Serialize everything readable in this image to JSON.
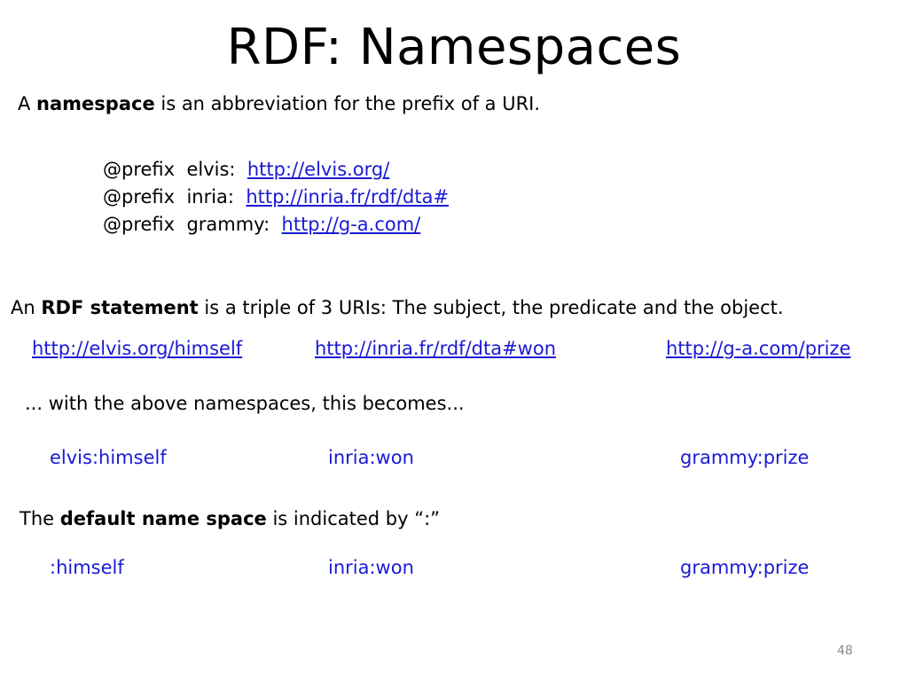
{
  "slide": {
    "title": "RDF: Namespaces",
    "page_number": "48"
  },
  "intro": {
    "pre": "A ",
    "term": "namespace",
    "post": " is an abbreviation for the prefix of a URI."
  },
  "prefixes": [
    {
      "keyword": "@prefix",
      "name": "elvis:",
      "uri": "http://elvis.org/"
    },
    {
      "keyword": "@prefix",
      "name": "inria:",
      "uri": "http://inria.fr/rdf/dta#"
    },
    {
      "keyword": "@prefix",
      "name": "grammy:",
      "uri": "http://g-a.com/"
    }
  ],
  "statement": {
    "pre": "An ",
    "term": "RDF statement",
    "post": " is a triple of 3 URIs: The subject, the predicate and the object."
  },
  "triple_full": {
    "subject": "http://elvis.org/himself",
    "predicate": "http://inria.fr/rdf/dta#won",
    "object": "http://g-a.com/prize"
  },
  "transition": "... with the above namespaces, this becomes...",
  "triple_prefixed": {
    "subject": "elvis:himself",
    "predicate": "inria:won",
    "object": "grammy:prize"
  },
  "default_ns": {
    "pre": "The ",
    "term": "default name space",
    "post": " is indicated by “:”"
  },
  "triple_default": {
    "subject": ":himself",
    "predicate": "inria:won",
    "object": "grammy:prize"
  },
  "colors": {
    "link": "#1a1ad6",
    "text": "#000000",
    "page_number": "#8a8a8a"
  }
}
